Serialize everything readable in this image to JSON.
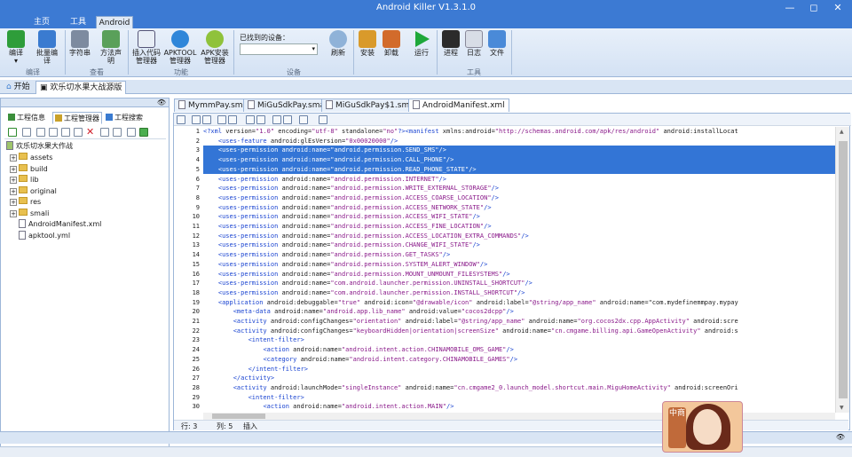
{
  "window": {
    "title": "Android Killer V1.3.1.0"
  },
  "menu_tabs": [
    {
      "label": "主页"
    },
    {
      "label": "工具"
    },
    {
      "label": "Android"
    }
  ],
  "ribbon": {
    "groups": [
      {
        "label": "编译"
      },
      {
        "label": "查看"
      },
      {
        "label": "功能"
      },
      {
        "label": "设备"
      },
      {
        "label": "工具"
      }
    ],
    "buttons": {
      "compile": "编译",
      "batch_compile": "批量编译",
      "string": "字符串",
      "method_desc": "方法声明",
      "plugin_manager": "插入代码管理器",
      "apktool_manager": "APKTOOL管理器",
      "apk_installer": "APK安装管理器",
      "refresh": "刷新",
      "install": "安装",
      "uninstall": "卸载",
      "run": "运行",
      "process": "进程",
      "log": "日志",
      "file": "文件"
    },
    "device_label": "已找到的设备：",
    "device_value": ""
  },
  "doc_tabs_top": [
    {
      "label": "开始"
    },
    {
      "label": "欢乐切水果大战源版"
    }
  ],
  "left_panel": {
    "tabs": [
      {
        "label": "工程信息"
      },
      {
        "label": "工程管理器"
      },
      {
        "label": "工程搜索"
      }
    ],
    "tree": {
      "root": "欢乐切水果大作战",
      "items": [
        {
          "label": "assets",
          "type": "folder"
        },
        {
          "label": "build",
          "type": "folder"
        },
        {
          "label": "lib",
          "type": "folder"
        },
        {
          "label": "original",
          "type": "folder"
        },
        {
          "label": "res",
          "type": "folder"
        },
        {
          "label": "smali",
          "type": "folder"
        },
        {
          "label": "AndroidManifest.xml",
          "type": "file"
        },
        {
          "label": "apktool.yml",
          "type": "file"
        }
      ]
    }
  },
  "editor_tabs": [
    {
      "label": "MymmPay.smali"
    },
    {
      "label": "MiGuSdkPay.smali"
    },
    {
      "label": "MiGuSdkPay$1.smali"
    },
    {
      "label": "AndroidManifest.xml"
    }
  ],
  "code_lines": [
    "<?xml version=\"1.0\" encoding=\"utf-8\" standalone=\"no\"?><manifest xmlns:android=\"http://schemas.android.com/apk/res/android\" android:installLocat",
    "    <uses-feature android:glEsVersion=\"0x00020000\"/>",
    "    <uses-permission android:name=\"android.permission.SEND_SMS\"/>",
    "    <uses-permission android:name=\"android.permission.CALL_PHONE\"/>",
    "    <uses-permission android:name=\"android.permission.READ_PHONE_STATE\"/>",
    "    <uses-permission android:name=\"android.permission.INTERNET\"/>",
    "    <uses-permission android:name=\"android.permission.WRITE_EXTERNAL_STORAGE\"/>",
    "    <uses-permission android:name=\"android.permission.ACCESS_COARSE_LOCATION\"/>",
    "    <uses-permission android:name=\"android.permission.ACCESS_NETWORK_STATE\"/>",
    "    <uses-permission android:name=\"android.permission.ACCESS_WIFI_STATE\"/>",
    "    <uses-permission android:name=\"android.permission.ACCESS_FINE_LOCATION\"/>",
    "    <uses-permission android:name=\"android.permission.ACCESS_LOCATION_EXTRA_COMMANDS\"/>",
    "    <uses-permission android:name=\"android.permission.CHANGE_WIFI_STATE\"/>",
    "    <uses-permission android:name=\"android.permission.GET_TASKS\"/>",
    "    <uses-permission android:name=\"android.permission.SYSTEM_ALERT_WINDOW\"/>",
    "    <uses-permission android:name=\"android.permission.MOUNT_UNMOUNT_FILESYSTEMS\"/>",
    "    <uses-permission android:name=\"com.android.launcher.permission.UNINSTALL_SHORTCUT\"/>",
    "    <uses-permission android:name=\"com.android.launcher.permission.INSTALL_SHORTCUT\"/>",
    "    <application android:debuggable=\"true\" android:icon=\"@drawable/icon\" android:label=\"@string/app_name\" android:name=\"com.mydefinemmpay.mypay",
    "        <meta-data android:name=\"android.app.lib_name\" android:value=\"cocos2dcpp\"/>",
    "        <activity android:configChanges=\"orientation\" android:label=\"@string/app_name\" android:name=\"org.cocos2dx.cpp.AppActivity\" android:scre",
    "        <activity android:configChanges=\"keyboardHidden|orientation|screenSize\" android:name=\"cn.cmgame.billing.api.GameOpenActivity\" android:s",
    "            <intent-filter>",
    "                <action android:name=\"android.intent.action.CHINAMOBILE_OMS_GAME\"/>",
    "                <category android:name=\"android.intent.category.CHINAMOBILE_GAMES\"/>",
    "            </intent-filter>",
    "        </activity>",
    "        <activity android:launchMode=\"singleInstance\" android:name=\"cn.cmgame2_0.launch_model.shortcut.main.MiguHomeActivity\" android:screenOri",
    "            <intent-filter>",
    "                <action android:name=\"android.intent.action.MAIN\"/>"
  ],
  "line_numbers": [
    "1",
    "2",
    "3",
    "4",
    "5",
    "6",
    "7",
    "8",
    "9",
    "10",
    "11",
    "12",
    "13",
    "14",
    "15",
    "16",
    "17",
    "18",
    "19",
    "20",
    "21",
    "22",
    "23",
    "24",
    "25",
    "26",
    "27",
    "28",
    "29",
    "30"
  ],
  "selected_lines": [
    3,
    4,
    5
  ],
  "status": {
    "row": "行: 3",
    "col": "列: 5",
    "mode": "插入"
  },
  "badge_text": "中商",
  "colors": {
    "accent": "#3c7ad3",
    "selection": "#3375d6"
  }
}
